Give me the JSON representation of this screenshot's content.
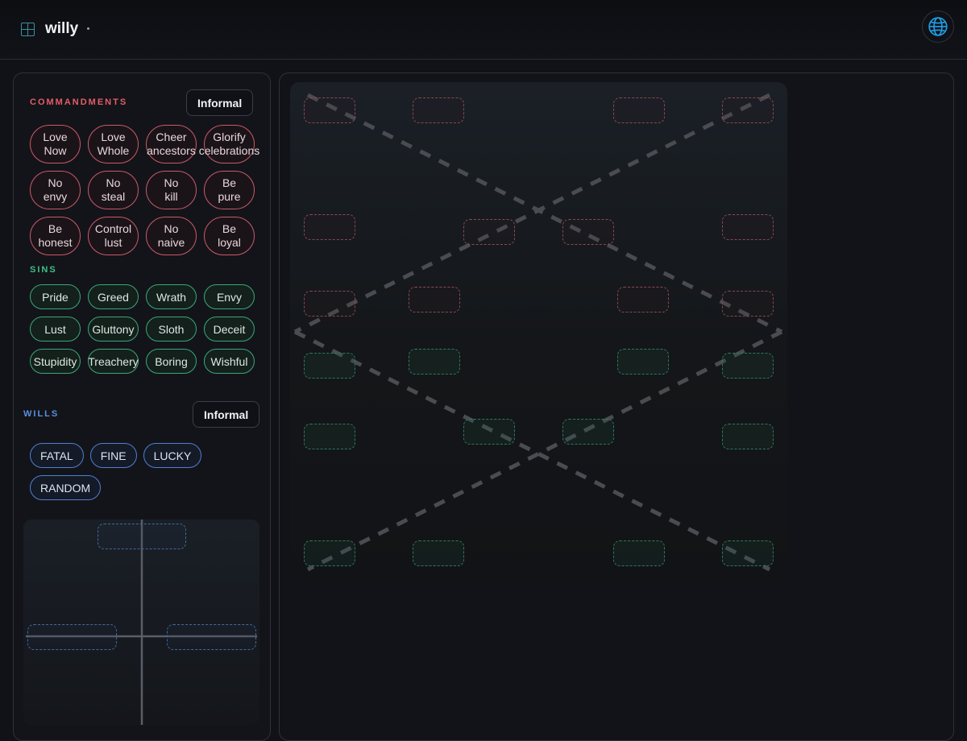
{
  "app": {
    "title": "willy"
  },
  "commandments": {
    "label": "COMMANDMENTS",
    "toggle_label": "Informal",
    "items": [
      "Love\nNow",
      "Love\nWhole",
      "Cheer\nancestors",
      "Glorify\ncelebrations",
      "No\nenvy",
      "No\nsteal",
      "No\nkill",
      "Be\npure",
      "Be\nhonest",
      "Control\nlust",
      "No\nnaive",
      "Be\nloyal"
    ]
  },
  "sins": {
    "label": "SINS",
    "items": [
      "Pride",
      "Greed",
      "Wrath",
      "Envy",
      "Lust",
      "Gluttony",
      "Sloth",
      "Deceit",
      "Stupidity",
      "Treachery",
      "Boring",
      "Wishful"
    ]
  },
  "wills": {
    "label": "WILLS",
    "toggle_label": "Informal",
    "items": [
      "FATAL",
      "FINE",
      "LUCKY",
      "RANDOM"
    ]
  },
  "colors": {
    "commandment_accent": "#e35d6a",
    "sin_accent": "#3fbf85",
    "will_accent": "#5b8fe0",
    "globe_icon": "#1e9be0"
  },
  "icons": {
    "logo": "grid-icon",
    "language": "globe-icon"
  }
}
